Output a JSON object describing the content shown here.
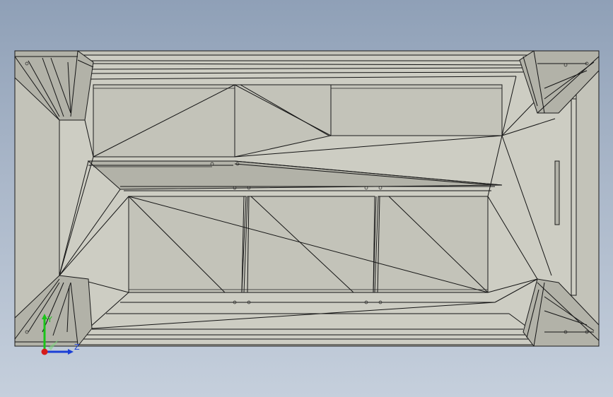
{
  "viewport": {
    "background_top": "#8fa0b7",
    "background_bottom": "#c5cfdc",
    "model_face_color": "#c3c3b9",
    "edge_color": "#141414"
  },
  "triad": {
    "x_label": "",
    "y_label": "Y",
    "z_label": "Z",
    "y_axis_color": "#19c419",
    "z_axis_color": "#1b3fd6",
    "x_axis_color": "#d61b1b"
  }
}
